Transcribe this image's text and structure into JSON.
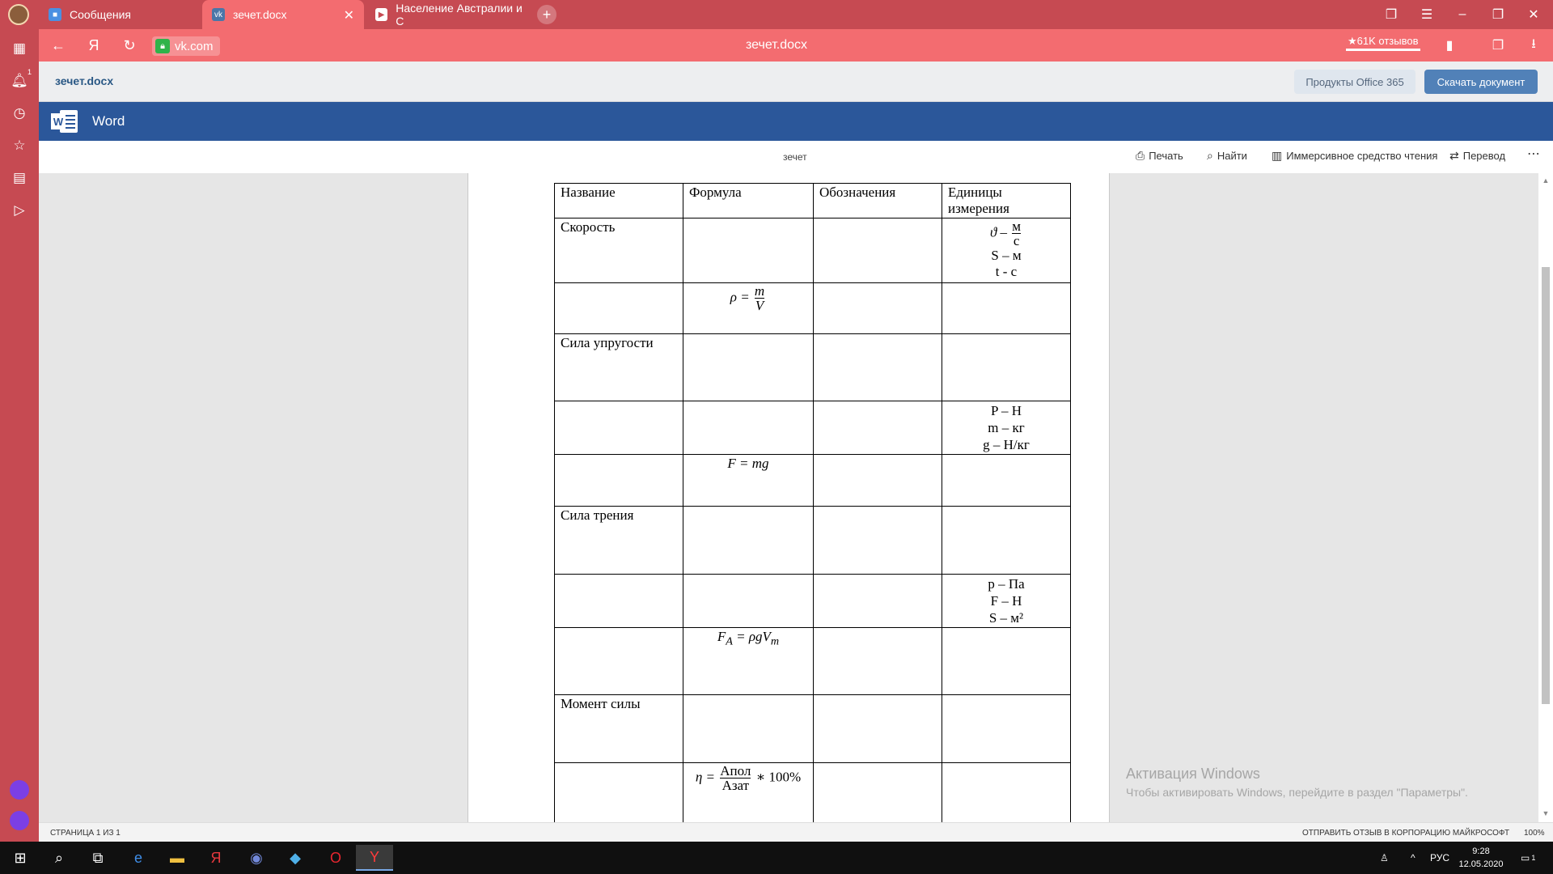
{
  "browser": {
    "tabs": [
      {
        "label": "Сообщения",
        "active": false
      },
      {
        "label": "зечет.docx",
        "active": true
      },
      {
        "label": "Население Австралии и С",
        "active": false
      }
    ],
    "address": "vk.com",
    "page_title": "зечет.docx",
    "reviews_label": "★61K отзывов",
    "notification_count": "1",
    "accent_color": "#f36c70"
  },
  "vk_bar": {
    "filename": "зечет.docx",
    "office_button": "Продукты Office 365",
    "download_button": "Скачать документ"
  },
  "word_bar": {
    "app_name": "Word",
    "doc_name": "зечет",
    "commands": {
      "print": "Печать",
      "find": "Найти",
      "immersive": "Иммерсивное средство чтения",
      "translate": "Перевод"
    }
  },
  "table": {
    "headers": [
      "Название",
      "Формула",
      "Обозначения",
      "Единицы измерения"
    ],
    "rows": [
      {
        "name": "Скорость",
        "units_fraction": {
          "left": "ϑ –",
          "num": "м",
          "den": "с"
        },
        "units_lines": [
          "S – м",
          "t - с"
        ]
      },
      {
        "formula": {
          "left": "ρ =",
          "num": "m",
          "den": "V"
        }
      },
      {
        "name": "Сила упругости"
      },
      {
        "units": [
          "P – Н",
          "m – кг",
          "g – Н/кг"
        ]
      },
      {
        "formula_text": "F = mg"
      },
      {
        "name": "Сила трения"
      },
      {
        "units": [
          "p – Па",
          "F – Н",
          "S – м²"
        ]
      },
      {
        "formula_text": "F",
        "formula_sub": "A",
        "formula_rest": " = ρgV",
        "formula_sub2": "m"
      },
      {
        "name": "Момент силы"
      },
      {
        "formula": {
          "left": "η =",
          "num": "Aпол",
          "den": "Aзат",
          "right": "∗ 100%"
        }
      }
    ]
  },
  "watermark": {
    "line1": "Активация Windows",
    "line2": "Чтобы активировать Windows, перейдите в раздел \"Параметры\"."
  },
  "status": {
    "page": "СТРАНИЦА 1 ИЗ 1",
    "feedback": "ОТПРАВИТЬ ОТЗЫВ В КОРПОРАЦИЮ МАЙКРОСОФТ",
    "zoom": "100%"
  },
  "taskbar": {
    "lang": "РУС",
    "time": "9:28",
    "date": "12.05.2020",
    "notifications": "1"
  }
}
